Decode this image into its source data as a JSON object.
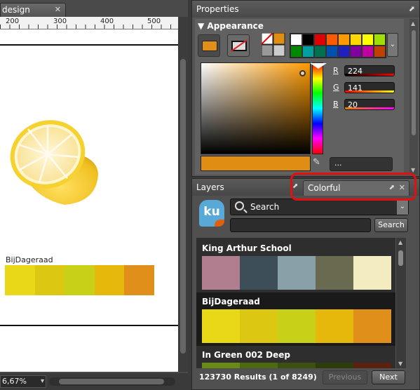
{
  "document": {
    "tab_title": "design",
    "tab_close": "✕",
    "ruler_labels": [
      "200",
      "300",
      "400",
      "500"
    ],
    "swatch_label": "BijDageraad",
    "swatch_colors": [
      "#e8d818",
      "#dcc812",
      "#c8d018",
      "#e6b80c",
      "#e0901a"
    ],
    "zoom": "6,67%",
    "zoom_dropdown": "▾"
  },
  "properties": {
    "title": "Properties",
    "undock": "⬈",
    "appearance_label": "▼ Appearance",
    "fill_color": "#e09018",
    "palette": [
      "#ffffff",
      "#000000",
      "#e00000",
      "#ff5a00",
      "#ff9a00",
      "#ffd800",
      "#ffff00",
      "#a0e000",
      "#008800",
      "#00a0a0",
      "#007050",
      "#0050b0",
      "#2020c0",
      "#8000a0",
      "#c000a0",
      "#c04000"
    ],
    "palette_dropdown": "⌄",
    "r_label": "R",
    "g_label": "G",
    "b_label": "B",
    "r_value": "224",
    "g_value": "141",
    "b_value": "20",
    "r_fraction": 0.878,
    "g_fraction": 0.553,
    "b_fraction": 0.078,
    "current_color": "#e08d14",
    "eyedropper": "✎",
    "more_label": "..."
  },
  "lower_panel": {
    "layers_tab": "Layers",
    "layers_undock": "⬈",
    "colorful_tab": "Colorful",
    "colorful_undock": "⬈",
    "colorful_close": "✕",
    "logo": "ku",
    "search_mode": "Search",
    "search_dropdown": "⌄",
    "search_value": "",
    "search_button": "Search",
    "themes": [
      {
        "name": "King Arthur School",
        "colors": [
          "#b07e8e",
          "#3e4e58",
          "#8aa0a8",
          "#6a6a50",
          "#f2ecc0"
        ]
      },
      {
        "name": "BijDageraad",
        "colors": [
          "#e8d818",
          "#dcc812",
          "#c8d018",
          "#e6b80c",
          "#e0901a"
        ]
      },
      {
        "name": "In Green 002 Deep",
        "colors": [
          "#6a8a18",
          "#4e6a10",
          "#3c5010",
          "#2c3c0c",
          "#5a2010"
        ]
      }
    ],
    "results": "123730 Results (1 of 8249)",
    "previous_button": "Previous",
    "next_button": "Next"
  }
}
